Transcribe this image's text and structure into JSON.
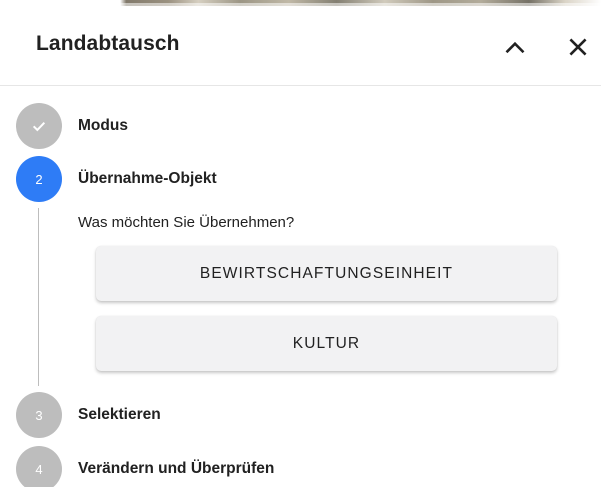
{
  "header": {
    "title": "Landabtausch"
  },
  "steps": [
    {
      "number": "",
      "label": "Modus",
      "state": "done"
    },
    {
      "number": "2",
      "label": "Übernahme-Objekt",
      "state": "active"
    },
    {
      "number": "3",
      "label": "Selektieren",
      "state": "todo"
    },
    {
      "number": "4",
      "label": "Verändern und Überprüfen",
      "state": "todo"
    }
  ],
  "active_step": {
    "question": "Was möchten Sie Übernehmen?",
    "options": [
      {
        "label": "BEWIRTSCHAFTUNGSEINHEIT"
      },
      {
        "label": "KULTUR"
      }
    ]
  },
  "colors": {
    "active": "#2e7cf6",
    "inactive": "#bdbdbd",
    "button_bg": "#f2f2f3"
  }
}
